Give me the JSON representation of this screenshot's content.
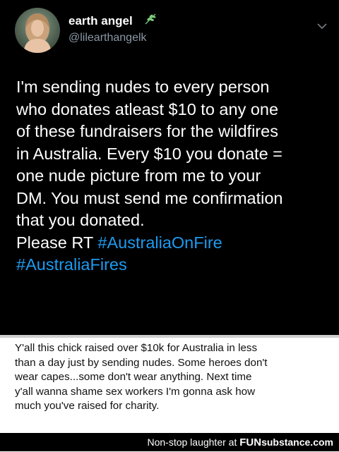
{
  "tweet": {
    "display_name": "earth angel",
    "handle": "@lilearthangelk",
    "avatar_icon": "profile-avatar",
    "name_icon": "leaf-sprig-icon",
    "menu_icon": "chevron-down-icon",
    "text_lines": [
      "I'm sending nudes to every person",
      "who donates atleast $10 to any one",
      "of these fundraisers for the wildfires",
      "in Australia. Every $10 you donate =",
      "one nude picture from me to your",
      "DM. You must send me confirmation",
      "that you donated."
    ],
    "rt_prefix": "Please RT",
    "hashtags": [
      "#AustraliaOnFire",
      "#AustraliaFires"
    ],
    "hashtag_color": "#1d9bf0"
  },
  "caption": {
    "lines": [
      "Y'all this chick raised over $10k for Australia in less",
      "than a day just by sending nudes. Some heroes don't",
      "wear capes...some don't wear anything. Next time",
      "y'all wanna shame sex workers I'm gonna ask how",
      "much you've raised for charity."
    ]
  },
  "footer": {
    "tagline": "Non-stop laughter at",
    "brand_mark": "FUN",
    "brand_rest": "substance.com"
  }
}
